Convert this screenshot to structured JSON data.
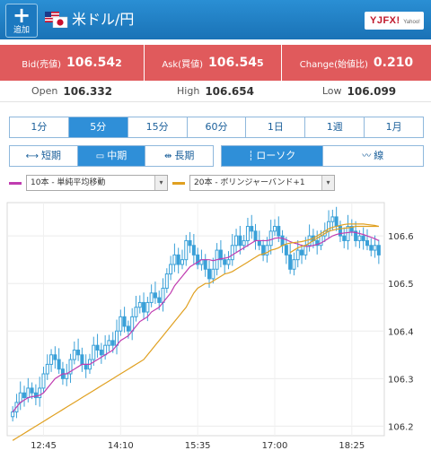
{
  "header": {
    "add_label": "追加",
    "add_icon": "plus-icon",
    "pair_name": "米ドル/円",
    "brand_name": "YJFX!",
    "brand_sub": "Yahoo!"
  },
  "quote": {
    "bid_label": "Bid(売値)",
    "bid_main": "106.54",
    "bid_pip": "2",
    "ask_label": "Ask(買値)",
    "ask_main": "106.54",
    "ask_pip": "5",
    "change_label": "Change(始値比)",
    "change_value": "0.210",
    "color": "#e05a5c"
  },
  "stats": {
    "open_label": "Open",
    "open_value": "106.332",
    "high_label": "High",
    "high_value": "106.654",
    "low_label": "Low",
    "low_value": "106.099"
  },
  "timeframes": [
    "1分",
    "5分",
    "15分",
    "60分",
    "1日",
    "1週",
    "1月"
  ],
  "active_timeframe": "5分",
  "periods": [
    {
      "label": "短期",
      "icon": "short-range-icon"
    },
    {
      "label": "中期",
      "icon": "mid-range-icon"
    },
    {
      "label": "長期",
      "icon": "long-range-icon"
    }
  ],
  "active_period": "中期",
  "chart_types": [
    {
      "label": "ローソク",
      "icon": "candlestick-icon"
    },
    {
      "label": "線",
      "icon": "line-chart-icon"
    }
  ],
  "active_chart_type": "ローソク",
  "indicators": [
    {
      "label": "10本 - 単純平均移動",
      "color": "#c03cb0"
    },
    {
      "label": "20本 - ボリンジャーバンド+1",
      "color": "#e0a020"
    }
  ],
  "chart_data": {
    "type": "candlestick",
    "x_ticks": [
      "12:45",
      "14:10",
      "15:35",
      "17:00",
      "18:25"
    ],
    "y_ticks": [
      "106.6",
      "106.5",
      "106.4",
      "106.3",
      "106.2"
    ],
    "ylim": [
      106.18,
      106.67
    ],
    "candle_color": "#3aa0d8",
    "ma_color": "#c03cb0",
    "band_color": "#e0a020",
    "closes": [
      106.23,
      106.25,
      106.27,
      106.26,
      106.28,
      106.27,
      106.26,
      106.28,
      106.31,
      106.33,
      106.35,
      106.34,
      106.32,
      106.3,
      106.31,
      106.34,
      106.36,
      106.35,
      106.33,
      106.32,
      106.34,
      106.37,
      106.36,
      106.35,
      106.37,
      106.38,
      106.37,
      106.4,
      106.43,
      106.41,
      106.4,
      106.43,
      106.45,
      106.46,
      106.44,
      106.46,
      106.48,
      106.47,
      106.46,
      106.49,
      106.52,
      106.54,
      106.56,
      106.54,
      106.55,
      106.59,
      106.58,
      106.56,
      106.54,
      106.55,
      106.53,
      106.51,
      106.53,
      106.57,
      106.55,
      106.54,
      106.55,
      106.58,
      106.6,
      106.58,
      106.59,
      106.62,
      106.61,
      106.59,
      106.58,
      106.56,
      106.58,
      106.61,
      106.62,
      106.6,
      106.58,
      106.56,
      106.53,
      106.55,
      106.57,
      106.56,
      106.58,
      106.6,
      106.59,
      106.58,
      106.6,
      106.61,
      106.63,
      106.64,
      106.62,
      106.6,
      106.59,
      106.62,
      106.61,
      106.59,
      106.6,
      106.59,
      106.58,
      106.57,
      106.58,
      106.56
    ],
    "ma10": [
      106.23,
      106.24,
      106.25,
      106.255,
      106.26,
      106.262,
      106.263,
      106.265,
      106.27,
      106.28,
      106.29,
      106.3,
      106.305,
      106.31,
      106.31,
      106.315,
      106.32,
      106.325,
      106.33,
      106.33,
      106.33,
      106.335,
      106.34,
      106.345,
      106.35,
      106.355,
      106.36,
      106.37,
      106.38,
      106.385,
      106.39,
      106.4,
      106.41,
      106.42,
      106.425,
      106.43,
      106.44,
      106.445,
      106.45,
      106.46,
      106.47,
      106.48,
      106.495,
      106.505,
      106.515,
      106.525,
      106.535,
      106.54,
      106.545,
      106.55,
      106.55,
      106.55,
      106.548,
      106.55,
      106.552,
      106.553,
      106.555,
      106.56,
      106.565,
      106.57,
      106.575,
      106.58,
      106.585,
      106.59,
      106.59,
      106.59,
      106.59,
      106.592,
      106.595,
      106.596,
      106.595,
      106.592,
      106.588,
      106.585,
      106.583,
      106.58,
      106.578,
      106.578,
      106.58,
      106.582,
      106.585,
      106.59,
      106.595,
      106.6,
      106.603,
      106.605,
      106.606,
      106.607,
      106.608,
      106.607,
      106.605,
      106.603,
      106.6,
      106.597,
      106.594,
      106.59
    ],
    "band_lower": [
      106.17,
      106.175,
      106.18,
      106.185,
      106.19,
      106.195,
      106.2,
      106.205,
      106.21,
      106.215,
      106.22,
      106.225,
      106.23,
      106.235,
      106.24,
      106.245,
      106.25,
      106.255,
      106.26,
      106.265,
      106.27,
      106.275,
      106.28,
      106.285,
      106.29,
      106.295,
      106.3,
      106.305,
      106.31,
      106.315,
      106.32,
      106.325,
      106.33,
      106.335,
      106.34,
      106.35,
      106.36,
      106.37,
      106.38,
      106.39,
      106.4,
      106.41,
      106.42,
      106.43,
      106.44,
      106.45,
      106.465,
      106.48,
      106.49,
      106.495,
      106.5,
      106.5,
      106.505,
      106.51,
      106.515,
      106.52,
      106.522,
      106.525,
      106.53,
      106.535,
      106.54,
      106.545,
      106.55,
      106.555,
      106.56,
      106.562,
      106.565,
      106.57,
      106.572,
      106.575,
      106.58,
      106.583,
      106.585,
      106.586,
      106.587,
      106.588,
      106.59,
      106.592,
      106.595,
      106.6,
      106.605,
      106.61,
      106.615,
      106.618,
      106.62,
      106.622,
      106.624,
      106.625,
      106.625,
      106.625,
      106.625,
      106.625,
      106.624,
      106.623,
      106.622,
      106.62
    ],
    "band_upper_tail": [
      106.565,
      106.57,
      106.575,
      106.578,
      106.58,
      106.585,
      106.59,
      106.595,
      106.6,
      106.605,
      106.61,
      106.612,
      106.614,
      106.615,
      106.616,
      106.617,
      106.618,
      106.62,
      106.62,
      106.62,
      106.62,
      106.62,
      106.62,
      106.62
    ]
  }
}
